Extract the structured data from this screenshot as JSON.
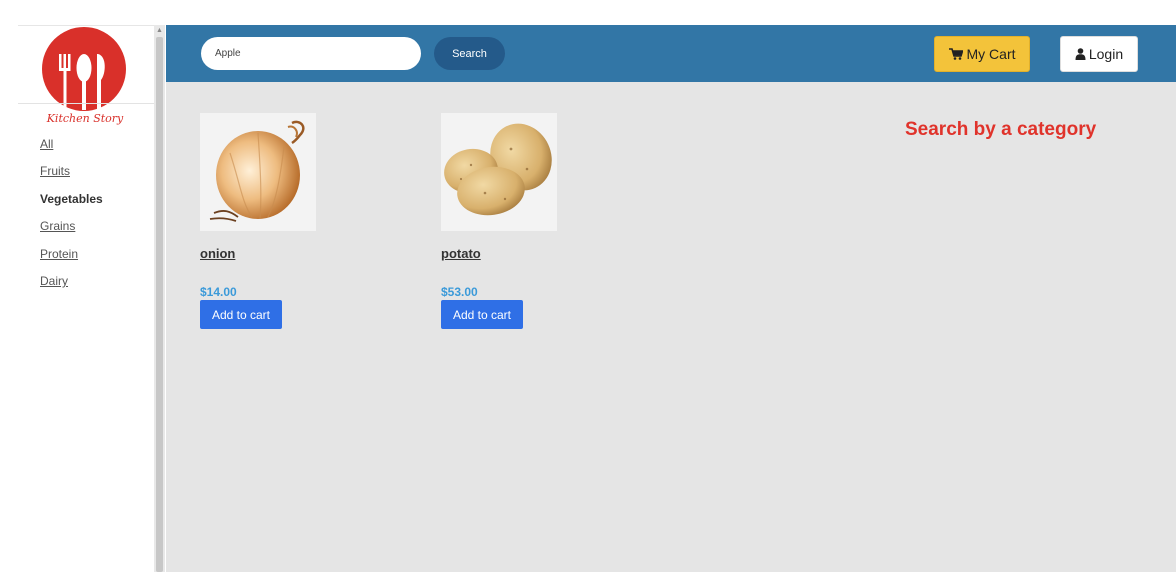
{
  "brand": {
    "name": "Kitchen Story"
  },
  "sidebar": {
    "categories": [
      {
        "label": "All"
      },
      {
        "label": "Fruits"
      },
      {
        "label": "Vegetables"
      },
      {
        "label": "Grains"
      },
      {
        "label": "Protein"
      },
      {
        "label": "Dairy"
      }
    ],
    "active_category": "Vegetables"
  },
  "header": {
    "search_value": "Apple",
    "search_button": "Search",
    "cart_label": "My Cart",
    "login_label": "Login"
  },
  "main": {
    "heading": "Search by a category",
    "products": [
      {
        "name": "onion",
        "price": "$14.00",
        "button": "Add to cart",
        "image": "onion-image"
      },
      {
        "name": "potato",
        "price": "$53.00",
        "button": "Add to cart",
        "image": "potato-image"
      }
    ]
  },
  "colors": {
    "topbar": "#3276a6",
    "search_button": "#245a8a",
    "cart_button": "#f3c33a",
    "add_button": "#2f6fe6",
    "price": "#3b9ad9",
    "heading": "#e0332b",
    "logo": "#d9302a",
    "content_bg": "#e5e5e5"
  }
}
